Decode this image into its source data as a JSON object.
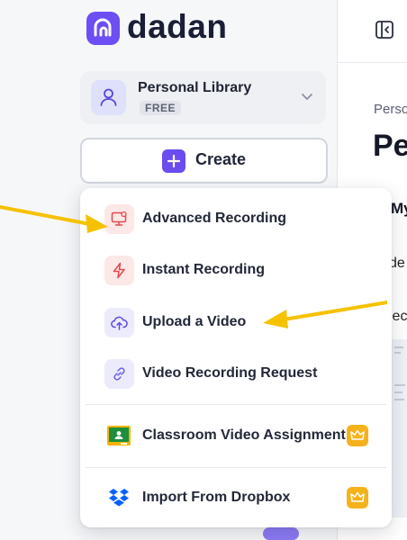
{
  "brand": {
    "name": "dadan"
  },
  "library": {
    "name": "Personal Library",
    "plan": "FREE"
  },
  "create": {
    "label": "Create"
  },
  "main": {
    "breadcrumb": "Perso",
    "title": "Pe",
    "tab": "My",
    "row1": "de",
    "row2": "lec"
  },
  "menu": {
    "items": [
      {
        "label": "Advanced Recording",
        "icon": "monitor-record-icon"
      },
      {
        "label": "Instant Recording",
        "icon": "lightning-icon"
      },
      {
        "label": "Upload a Video",
        "icon": "cloud-upload-icon"
      },
      {
        "label": "Video Recording Request",
        "icon": "link-icon"
      },
      {
        "label": "Classroom Video Assignment",
        "icon": "google-classroom-icon",
        "pro": true
      },
      {
        "label": "Import From Dropbox",
        "icon": "dropbox-icon",
        "pro": true
      }
    ]
  },
  "colors": {
    "accent": "#6c4ef2",
    "pro_badge": "#f5b21b",
    "annotation_arrow": "#f5c200"
  }
}
